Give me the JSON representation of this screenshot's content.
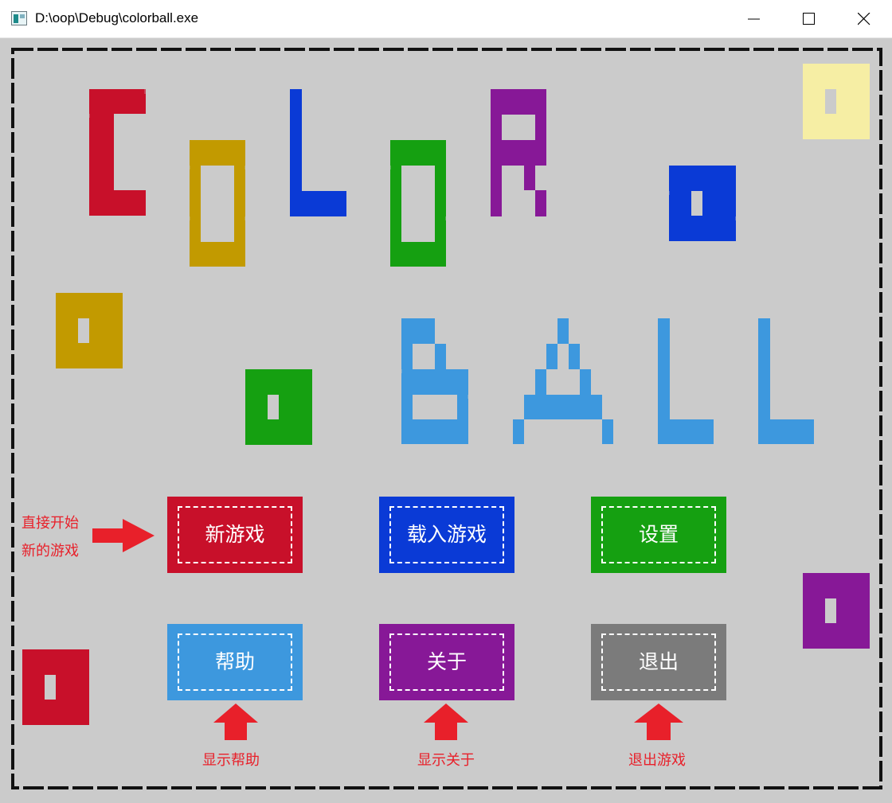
{
  "window": {
    "title": "D:\\oop\\Debug\\colorball.exe"
  },
  "menu": {
    "new_game": "新游戏",
    "load_game": "载入游戏",
    "settings": "设置",
    "help": "帮助",
    "about": "关于",
    "quit": "退出"
  },
  "hints": {
    "new_game_line1": "直接开始",
    "new_game_line2": "新的游戏",
    "help": "显示帮助",
    "about": "显示关于",
    "quit": "退出游戏"
  },
  "colors": {
    "background": "#cbcbcb",
    "red": "#c8102a",
    "gold": "#c29a00",
    "blue": "#0a3ad6",
    "green": "#15a011",
    "purple": "#871897",
    "light_blue": "#3d98de",
    "grey": "#7b7b7b",
    "cream": "#f6eea4",
    "hint_red": "#e8202a"
  }
}
